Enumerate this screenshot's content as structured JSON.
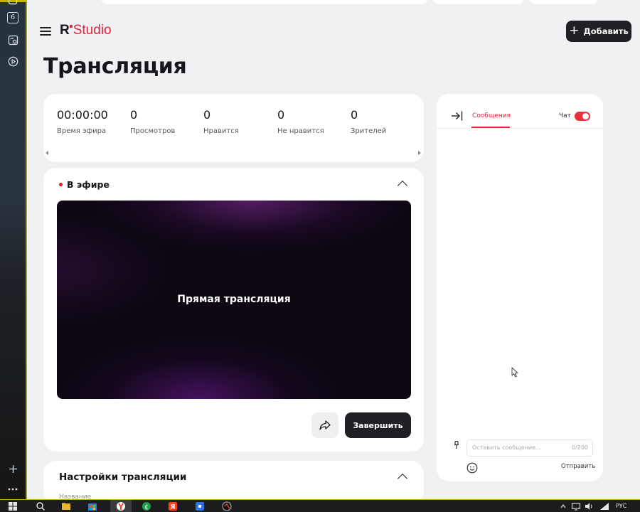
{
  "side_strip": {
    "badge_label": "6"
  },
  "header": {
    "logo_r": "R",
    "logo_studio": "Studio",
    "add_button_label": "Добавить"
  },
  "page": {
    "title": "Трансляция"
  },
  "stats": [
    {
      "value": "00:00:00",
      "label": "Время эфира"
    },
    {
      "value": "0",
      "label": "Просмотров"
    },
    {
      "value": "0",
      "label": "Нравится"
    },
    {
      "value": "0",
      "label": "Не нравится"
    },
    {
      "value": "0",
      "label": "Зрителей"
    }
  ],
  "live": {
    "status_label": "В эфире",
    "video_label": "Прямая трансляция",
    "finish_button_label": "Завершить"
  },
  "settings": {
    "title": "Настройки трансляции",
    "first_field_label": "Название"
  },
  "chat": {
    "tab_label": "Сообщения",
    "toggle_label": "Чат",
    "toggle_on": true,
    "input_placeholder": "Оставить сообщение...",
    "char_counter": "0/200",
    "send_label": "Отправить"
  },
  "taskbar": {
    "language": "РУС"
  },
  "colors": {
    "accent": "#e8203a",
    "dark_button": "#1f2023",
    "background": "#f0f1f3"
  }
}
